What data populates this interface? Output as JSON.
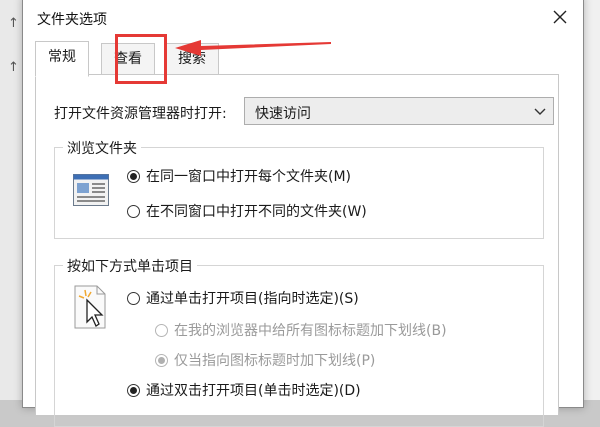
{
  "dialog": {
    "title": "文件夹选项",
    "close_icon": "close-icon"
  },
  "tabs": [
    {
      "label": "常规",
      "active": true
    },
    {
      "label": "查看",
      "active": false,
      "highlighted": true
    },
    {
      "label": "搜索",
      "active": false
    }
  ],
  "general": {
    "open_explorer_label": "打开文件资源管理器时打开:",
    "open_explorer_value": "快速访问",
    "browse_group": {
      "legend": "浏览文件夹",
      "options": [
        {
          "label": "在同一窗口中打开每个文件夹(M)",
          "checked": true,
          "disabled": false
        },
        {
          "label": "在不同窗口中打开不同的文件夹(W)",
          "checked": false,
          "disabled": false
        }
      ]
    },
    "click_group": {
      "legend": "按如下方式单击项目",
      "options": [
        {
          "label": "通过单击打开项目(指向时选定)(S)",
          "checked": false,
          "disabled": false
        },
        {
          "label": "在我的浏览器中给所有图标标题加下划线(B)",
          "checked": false,
          "disabled": true
        },
        {
          "label": "仅当指向图标标题时加下划线(P)",
          "checked": true,
          "disabled": true
        },
        {
          "label": "通过双击打开项目(单击时选定)(D)",
          "checked": true,
          "disabled": false
        }
      ]
    }
  },
  "annotation": {
    "box_color": "#e53935",
    "arrow_color": "#e53935"
  }
}
